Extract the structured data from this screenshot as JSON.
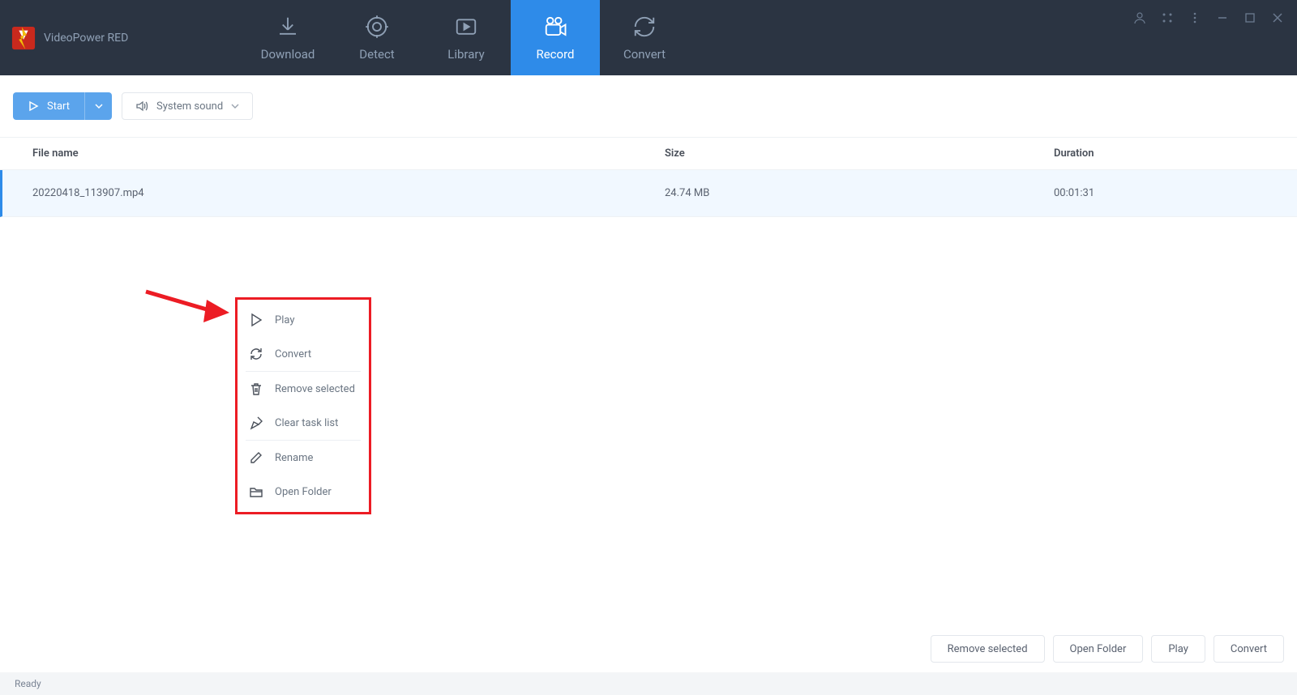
{
  "app": {
    "title": "VideoPower RED"
  },
  "nav": {
    "download": "Download",
    "detect": "Detect",
    "library": "Library",
    "record": "Record",
    "convert": "Convert"
  },
  "toolbar": {
    "start": "Start",
    "sound_mode": "System sound"
  },
  "columns": {
    "filename": "File name",
    "size": "Size",
    "duration": "Duration"
  },
  "rows": [
    {
      "filename": "20220418_113907.mp4",
      "size": "24.74 MB",
      "duration": "00:01:31"
    }
  ],
  "context_menu": {
    "play": "Play",
    "convert": "Convert",
    "remove_selected": "Remove selected",
    "clear_task_list": "Clear task list",
    "rename": "Rename",
    "open_folder": "Open Folder"
  },
  "footer": {
    "remove_selected": "Remove selected",
    "open_folder": "Open Folder",
    "play": "Play",
    "convert": "Convert"
  },
  "status": {
    "text": "Ready"
  }
}
